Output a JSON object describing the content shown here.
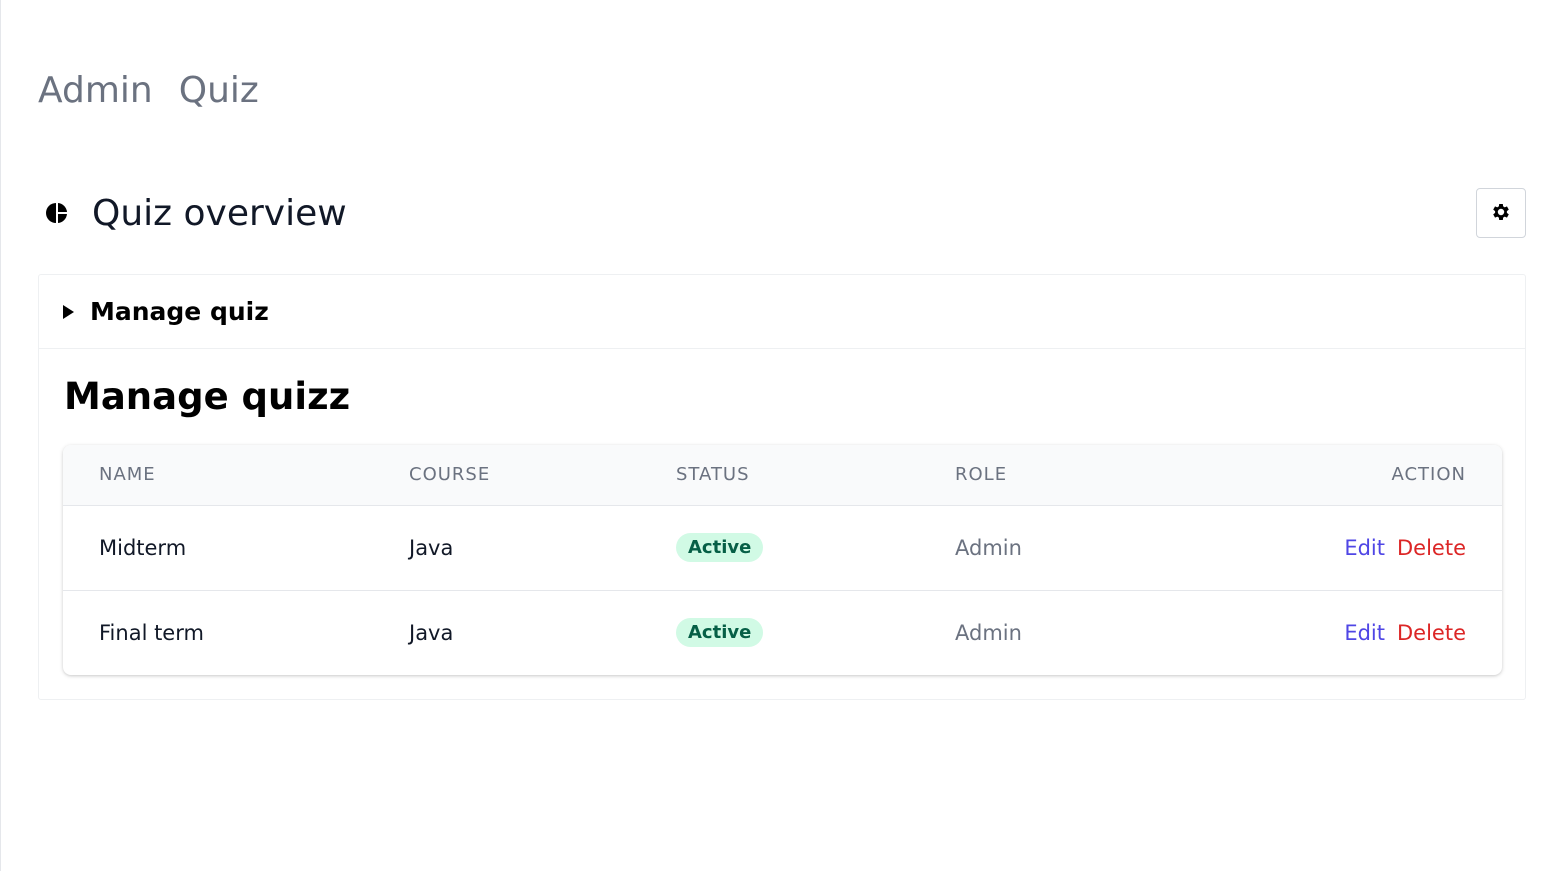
{
  "breadcrumb": {
    "items": [
      "Admin",
      "Quiz"
    ]
  },
  "header": {
    "title": "Quiz overview",
    "title_icon": "pie-chart-icon",
    "settings_icon": "gear-icon"
  },
  "card": {
    "toggle_label": "Manage quiz",
    "section_title": "Manage quizz"
  },
  "table": {
    "columns": [
      "NAME",
      "COURSE",
      "STATUS",
      "ROLE",
      "ACTION"
    ],
    "rows": [
      {
        "name": "Midterm",
        "course": "Java",
        "status": "Active",
        "role": "Admin",
        "edit": "Edit",
        "delete": "Delete"
      },
      {
        "name": "Final term",
        "course": "Java",
        "status": "Active",
        "role": "Admin",
        "edit": "Edit",
        "delete": "Delete"
      }
    ]
  },
  "colors": {
    "edit_link": "#4f46e5",
    "delete_link": "#dc2626",
    "status_active_bg": "#d1fae5",
    "status_active_text": "#065f46"
  }
}
